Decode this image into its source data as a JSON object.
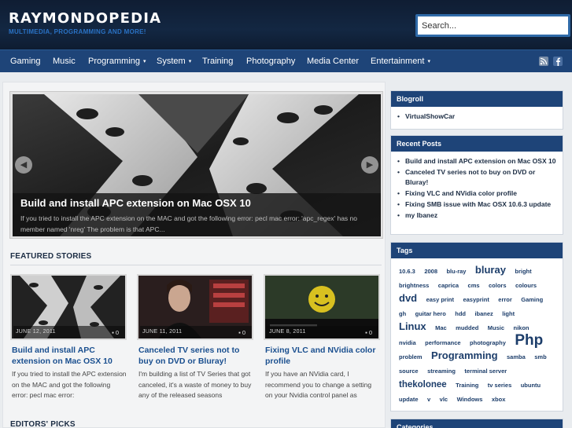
{
  "site": {
    "title": "RAYMONDOPEDIA",
    "tagline": "MULTIMEDIA, PROGRAMMING AND MORE!"
  },
  "search": {
    "placeholder": "Search..."
  },
  "nav": {
    "items": [
      {
        "label": "Gaming",
        "dropdown": false
      },
      {
        "label": "Music",
        "dropdown": false
      },
      {
        "label": "Programming",
        "dropdown": true
      },
      {
        "label": "System",
        "dropdown": true
      },
      {
        "label": "Training",
        "dropdown": false
      },
      {
        "label": "Photography",
        "dropdown": false
      },
      {
        "label": "Media Center",
        "dropdown": false
      },
      {
        "label": "Entertainment",
        "dropdown": true
      }
    ],
    "icons": [
      "rss-icon",
      "facebook-icon"
    ]
  },
  "slider": {
    "title": "Build and install APC extension on Mac OSX 10",
    "excerpt": "If you tried to install the APC extension on the MAC and got the following error: pecl mac error: 'apc_regex' has no member named 'nreg' The problem is that APC...",
    "prev_icon": "chevron-left-icon",
    "next_icon": "chevron-right-icon"
  },
  "featured": {
    "heading": "FEATURED STORIES",
    "cards": [
      {
        "date": "JUNE 12, 2011",
        "comments": "0",
        "title": "Build and install APC extension on Mac OSX 10",
        "excerpt": "If you tried to install the APC extension on the MAC and got the following error: pecl mac error:"
      },
      {
        "date": "JUNE 11, 2011",
        "comments": "0",
        "title": "Canceled TV series not to buy on DVD or Bluray!",
        "excerpt": "I'm building a list of TV Series that got canceled, it's a waste of money to buy any of the released seasons"
      },
      {
        "date": "JUNE 8, 2011",
        "comments": "0",
        "title": "Fixing VLC and NVidia color profile",
        "excerpt": "If you have an NVidia card, I recommend you to change a setting on your Nvidia control panel as"
      }
    ]
  },
  "editors": {
    "heading": "EDITORS' PICKS"
  },
  "sidebar": {
    "blogroll": {
      "title": "Blogroll",
      "items": [
        "VirtualShowCar"
      ]
    },
    "recent": {
      "title": "Recent Posts",
      "items": [
        "Build and install APC extension on Mac OSX 10",
        "Canceled TV series not to buy on DVD or Bluray!",
        "Fixing VLC and NVidia color profile",
        "Fixing SMB issue with Mac OSX 10.6.3 update",
        "my Ibanez"
      ]
    },
    "tags": {
      "title": "Tags",
      "items": [
        {
          "label": "10.6.3",
          "size": 1
        },
        {
          "label": "2008",
          "size": 1
        },
        {
          "label": "blu-ray",
          "size": 1
        },
        {
          "label": "bluray",
          "size": 3
        },
        {
          "label": "bright",
          "size": 1
        },
        {
          "label": "brightness",
          "size": 1
        },
        {
          "label": "caprica",
          "size": 1
        },
        {
          "label": "cms",
          "size": 1
        },
        {
          "label": "colors",
          "size": 1
        },
        {
          "label": "colours",
          "size": 1
        },
        {
          "label": "dvd",
          "size": 3
        },
        {
          "label": "easy print",
          "size": 1
        },
        {
          "label": "easyprint",
          "size": 1
        },
        {
          "label": "error",
          "size": 1
        },
        {
          "label": "Gaming",
          "size": 1
        },
        {
          "label": "gh",
          "size": 1
        },
        {
          "label": "guitar hero",
          "size": 1
        },
        {
          "label": "hdd",
          "size": 1
        },
        {
          "label": "ibanez",
          "size": 1
        },
        {
          "label": "light",
          "size": 1
        },
        {
          "label": "Linux",
          "size": 3
        },
        {
          "label": "Mac",
          "size": 1
        },
        {
          "label": "mudded",
          "size": 1
        },
        {
          "label": "Music",
          "size": 1
        },
        {
          "label": "nikon",
          "size": 1
        },
        {
          "label": "nvidia",
          "size": 1
        },
        {
          "label": "performance",
          "size": 1
        },
        {
          "label": "photography",
          "size": 1
        },
        {
          "label": "Php",
          "size": 4
        },
        {
          "label": "problem",
          "size": 1
        },
        {
          "label": "Programming",
          "size": 3
        },
        {
          "label": "samba",
          "size": 1
        },
        {
          "label": "smb",
          "size": 1
        },
        {
          "label": "source",
          "size": 1
        },
        {
          "label": "streaming",
          "size": 1
        },
        {
          "label": "terminal server",
          "size": 1
        },
        {
          "label": "thekolonee",
          "size": 2
        },
        {
          "label": "Training",
          "size": 1
        },
        {
          "label": "tv series",
          "size": 1
        },
        {
          "label": "ubuntu",
          "size": 1
        },
        {
          "label": "update",
          "size": 1
        },
        {
          "label": "v",
          "size": 1
        },
        {
          "label": "vlc",
          "size": 1
        },
        {
          "label": "Windows",
          "size": 1
        },
        {
          "label": "xbox",
          "size": 1
        }
      ]
    },
    "categories": {
      "title": "Categories"
    }
  },
  "colors": {
    "header_bg": "#132742",
    "nav_bg": "#1e4478",
    "accent_blue": "#1a4f8f",
    "tagline_blue": "#2a72c4"
  }
}
